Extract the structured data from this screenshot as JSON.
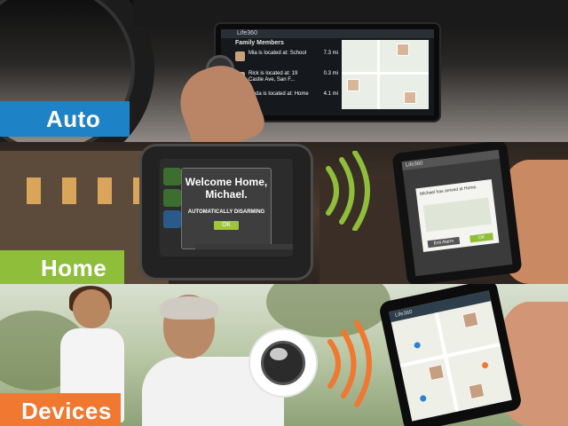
{
  "sections": {
    "auto": {
      "label": "Auto"
    },
    "home": {
      "label": "Home"
    },
    "devices": {
      "label": "Devices"
    }
  },
  "car_screen": {
    "app_title": "Life360",
    "header": "Family Members",
    "members": [
      {
        "text": "Mia is located at: School",
        "distance": "7.3 mi"
      },
      {
        "text": "Rick is located at: 19 Castle Ave, San F...",
        "distance": "0.3 mi"
      },
      {
        "text": "Linda is located at: Home",
        "distance": "4.1 mi"
      }
    ]
  },
  "tablet": {
    "title": "Welcome Home, Michael.",
    "subtitle": "AUTOMATICALLY DISARMING",
    "ok_label": "OK"
  },
  "phone_home": {
    "app_title": "Life360",
    "message": "Michael has arrived at Home.",
    "exit_label": "Exit Alarm",
    "ok_label": "OK"
  },
  "phone_devices": {
    "app_title": "Life360"
  },
  "colors": {
    "auto": "#1d82c6",
    "home": "#8ebe3a",
    "devices": "#f07830",
    "signal_green": "#8ebe3a",
    "signal_orange": "#f07830"
  }
}
